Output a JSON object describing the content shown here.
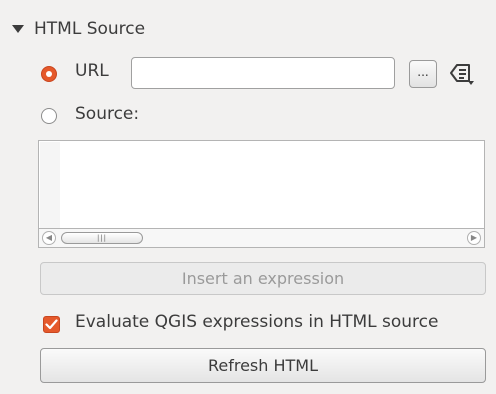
{
  "section": {
    "title": "HTML Source",
    "expanded": true
  },
  "url_option": {
    "label": "URL",
    "selected": true,
    "value": "",
    "browse_label": "...",
    "expression_icon": "data-defined-expression-icon"
  },
  "source_option": {
    "label": "Source:",
    "selected": false,
    "text": ""
  },
  "scrollbar": {
    "thumb_grip": "|||"
  },
  "insert_expression": {
    "label": "Insert an expression",
    "enabled": false
  },
  "evaluate": {
    "label": "Evaluate QGIS expressions in HTML source",
    "checked": true
  },
  "refresh": {
    "label": "Refresh HTML"
  },
  "colors": {
    "accent": "#e5592b",
    "background": "#f2f1f0"
  }
}
